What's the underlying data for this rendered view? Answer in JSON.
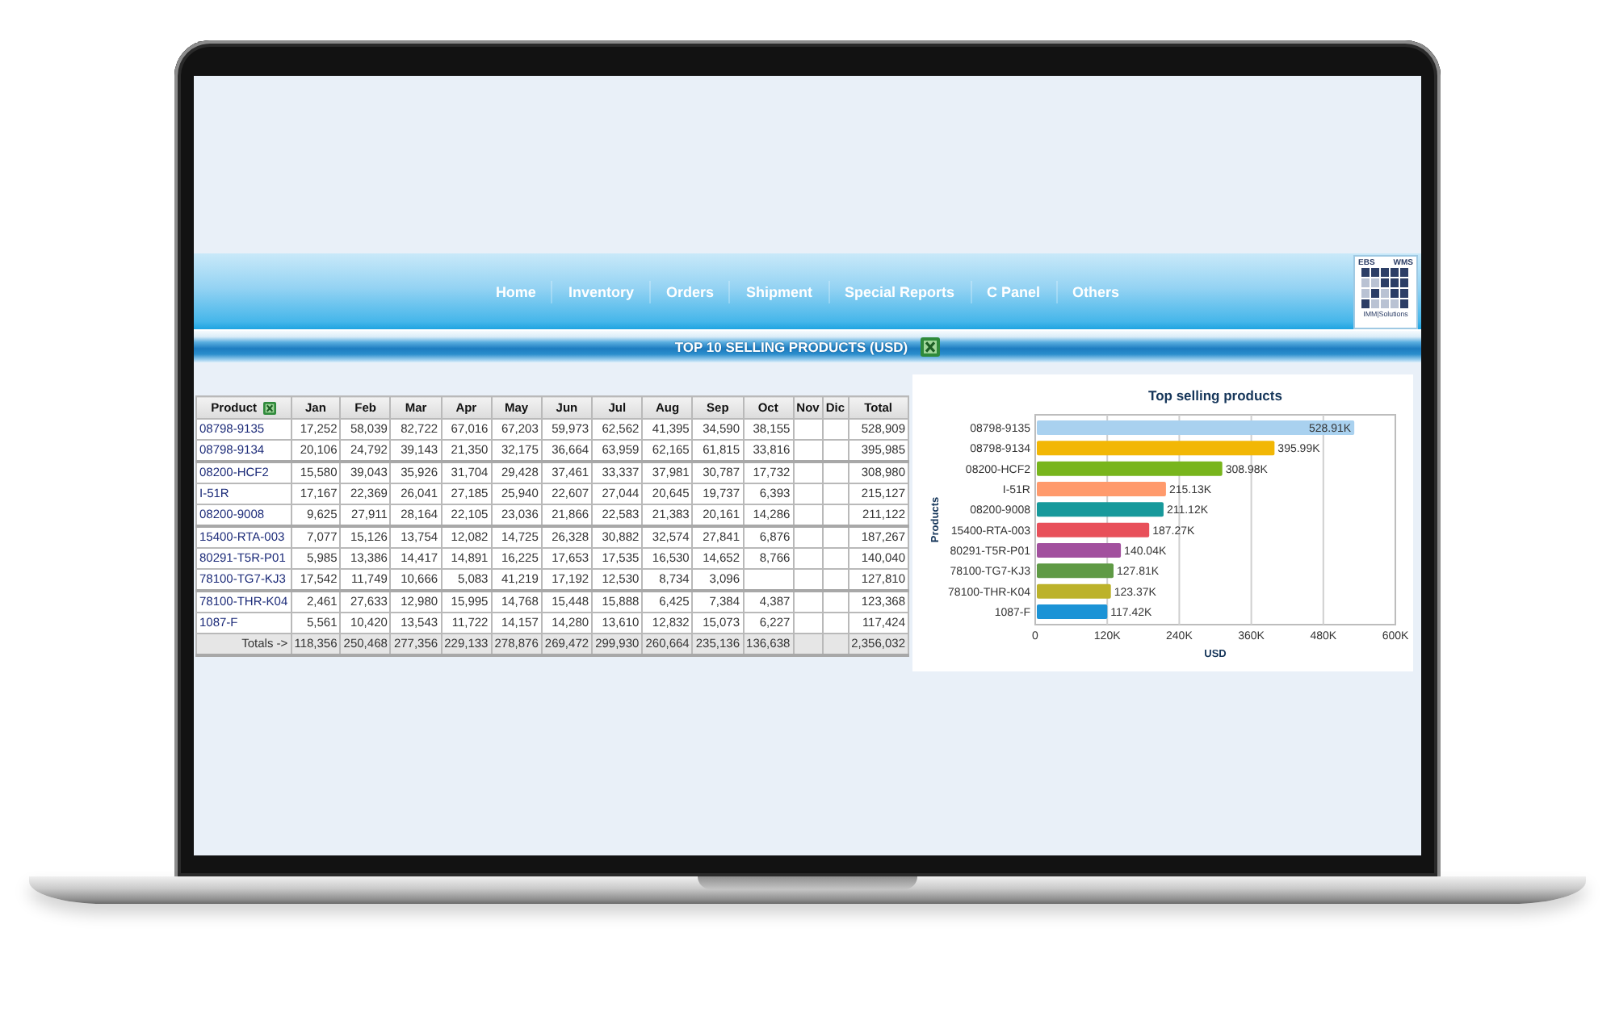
{
  "nav": {
    "items": [
      "Home",
      "Inventory",
      "Orders",
      "Shipment",
      "Special Reports",
      "C Panel",
      "Others"
    ],
    "logo": {
      "top_left": "EBS",
      "top_right": "WMS",
      "bottom": "IMM|Solutions"
    }
  },
  "report": {
    "title": "TOP 10 SELLING PRODUCTS (USD)"
  },
  "table": {
    "columns": [
      "Product",
      "Jan",
      "Feb",
      "Mar",
      "Apr",
      "May",
      "Jun",
      "Jul",
      "Aug",
      "Sep",
      "Oct",
      "Nov",
      "Dic",
      "Total"
    ],
    "rows": [
      {
        "kind": "product",
        "cells": [
          "08798-9135",
          "17,252",
          "58,039",
          "82,722",
          "67,016",
          "67,203",
          "59,973",
          "62,562",
          "41,395",
          "34,590",
          "38,155",
          "",
          "",
          "528,909"
        ]
      },
      {
        "kind": "product",
        "cells": [
          "08798-9134",
          "20,106",
          "24,792",
          "39,143",
          "21,350",
          "32,175",
          "36,664",
          "63,959",
          "62,165",
          "61,815",
          "33,816",
          "",
          "",
          "395,985"
        ]
      },
      {
        "kind": "product",
        "cells": [
          "08200-HCF2",
          "15,580",
          "39,043",
          "35,926",
          "31,704",
          "29,428",
          "37,461",
          "33,337",
          "37,981",
          "30,787",
          "17,732",
          "",
          "",
          "308,980"
        ]
      },
      {
        "kind": "product",
        "cells": [
          "I-51R",
          "17,167",
          "22,369",
          "26,041",
          "27,185",
          "25,940",
          "22,607",
          "27,044",
          "20,645",
          "19,737",
          "6,393",
          "",
          "",
          "215,127"
        ]
      },
      {
        "kind": "product",
        "cells": [
          "08200-9008",
          "9,625",
          "27,911",
          "28,164",
          "22,105",
          "23,036",
          "21,866",
          "22,583",
          "21,383",
          "20,161",
          "14,286",
          "",
          "",
          "211,122"
        ]
      },
      {
        "kind": "product",
        "cells": [
          "15400-RTA-003",
          "7,077",
          "15,126",
          "13,754",
          "12,082",
          "14,725",
          "26,328",
          "30,882",
          "32,574",
          "27,841",
          "6,876",
          "",
          "",
          "187,267"
        ]
      },
      {
        "kind": "product",
        "cells": [
          "80291-T5R-P01",
          "5,985",
          "13,386",
          "14,417",
          "14,891",
          "16,225",
          "17,653",
          "17,535",
          "16,530",
          "14,652",
          "8,766",
          "",
          "",
          "140,040"
        ]
      },
      {
        "kind": "product",
        "cells": [
          "78100-TG7-KJ3",
          "17,542",
          "11,749",
          "10,666",
          "5,083",
          "41,219",
          "17,192",
          "12,530",
          "8,734",
          "3,096",
          "",
          "",
          "",
          "127,810"
        ]
      },
      {
        "kind": "product",
        "cells": [
          "78100-THR-K04",
          "2,461",
          "27,633",
          "12,980",
          "15,995",
          "14,768",
          "15,448",
          "15,888",
          "6,425",
          "7,384",
          "4,387",
          "",
          "",
          "123,368"
        ]
      },
      {
        "kind": "product",
        "cells": [
          "1087-F",
          "5,561",
          "10,420",
          "13,543",
          "11,722",
          "14,157",
          "14,280",
          "13,610",
          "12,832",
          "15,073",
          "6,227",
          "",
          "",
          "117,424"
        ]
      },
      {
        "kind": "totals",
        "cells": [
          "Totals ->",
          "118,356",
          "250,468",
          "277,356",
          "229,133",
          "278,876",
          "269,472",
          "299,930",
          "260,664",
          "235,136",
          "136,638",
          "",
          "",
          "2,356,032"
        ]
      }
    ]
  },
  "chart": {
    "chart_data": {
      "type": "bar",
      "orientation": "horizontal",
      "title": "Top selling products",
      "xlabel": "USD",
      "ylabel": "Products",
      "categories": [
        "08798-9135",
        "08798-9134",
        "08200-HCF2",
        "I-51R",
        "08200-9008",
        "15400-RTA-003",
        "80291-T5R-P01",
        "78100-TG7-KJ3",
        "78100-THR-K04",
        "1087-F"
      ],
      "values": [
        528909,
        395985,
        308980,
        215127,
        211122,
        187267,
        140040,
        127810,
        123368,
        117424
      ],
      "colors": [
        "#a9d1ef",
        "#f2b705",
        "#78b51c",
        "#ff9a6c",
        "#17999b",
        "#e8505a",
        "#a2509e",
        "#5f9a45",
        "#bcb22a",
        "#1b93d6"
      ],
      "value_labels": [
        "528.91K",
        "395.99K",
        "308.98K",
        "215.13K",
        "211.12K",
        "187.27K",
        "140.04K",
        "127.81K",
        "123.37K",
        "117.42K"
      ],
      "xlim": [
        0,
        600000
      ],
      "xticks": [
        {
          "value": 0,
          "label": "0"
        },
        {
          "value": 120000,
          "label": "120K"
        },
        {
          "value": 240000,
          "label": "240K"
        },
        {
          "value": 360000,
          "label": "360K"
        },
        {
          "value": 480000,
          "label": "480K"
        },
        {
          "value": 600000,
          "label": "600K"
        }
      ],
      "grid": true
    }
  }
}
